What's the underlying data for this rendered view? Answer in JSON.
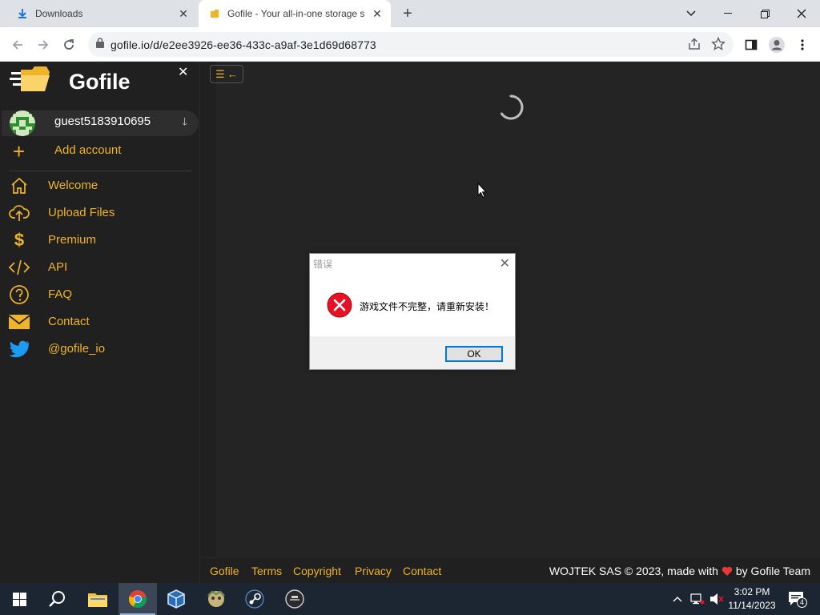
{
  "browser": {
    "tabs": [
      {
        "title": "Downloads"
      },
      {
        "title": "Gofile - Your all-in-one storage s"
      }
    ],
    "url": "gofile.io/d/e2ee3926-ee36-433c-a9af-3e1d69d68773"
  },
  "sidebar": {
    "brand": "Gofile",
    "account": "guest5183910695",
    "add_account": "Add account",
    "items": [
      {
        "label": "Welcome",
        "icon": "home-icon"
      },
      {
        "label": "Upload Files",
        "icon": "cloud-upload-icon"
      },
      {
        "label": "Premium",
        "icon": "dollar-icon"
      },
      {
        "label": "API",
        "icon": "code-icon"
      },
      {
        "label": "FAQ",
        "icon": "question-icon"
      },
      {
        "label": "Contact",
        "icon": "envelope-icon"
      },
      {
        "label": "@gofile_io",
        "icon": "twitter-icon"
      }
    ]
  },
  "footer": {
    "links": [
      "Gofile",
      "Terms",
      "Copyright",
      "Privacy",
      "Contact"
    ],
    "copyright_left": "WOJTEK SAS © 2023, made with",
    "copyright_right": "by Gofile Team"
  },
  "dialog": {
    "title": "错误",
    "message": "游戏文件不完整，请重新安装！",
    "ok": "OK"
  },
  "taskbar": {
    "time": "3:02 PM",
    "date": "11/14/2023",
    "notification_count": "4"
  },
  "colors": {
    "accent": "#f0b429",
    "background": "#242424",
    "sidebar": "#202020"
  }
}
